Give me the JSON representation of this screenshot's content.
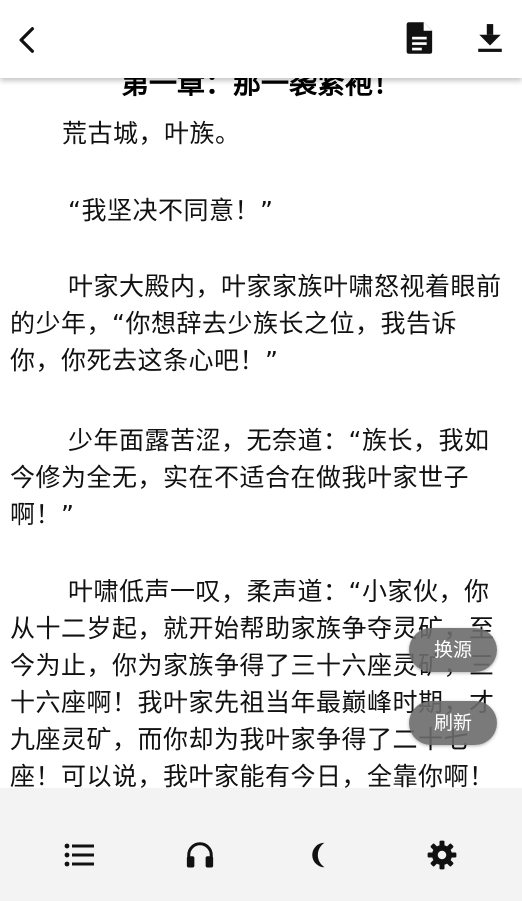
{
  "toolbar": {
    "back_icon": "chevron-left-icon",
    "document_icon": "document-icon",
    "download_icon": "download-icon"
  },
  "reader": {
    "chapter_title": "第一章：那一袭紧袍！",
    "paragraphs": [
      "荒古城，叶族。",
      "“我坚决不同意！”",
      "叶家大殿内，叶家家族叶啸怒视着眼前的少年，“你想辞去少族长之位，我告诉你，你死去这条心吧！”",
      "少年面露苦涩，无奈道：“族长，我如今修为全无，实在不适合在做我叶家世子啊！”",
      "叶啸低声一叹，柔声道：“小家伙，你从十二岁起，就开始帮助家族争夺灵矿，至今为止，你为家族争得了三十六座灵矿，三十六座啊！我叶家先祖当年最巅峰时期，才九座灵矿，而你却为我叶家争得了二十七座！可以说，我叶家能有今日，全靠你啊！你现在虽然修为全无，但是……你"
    ]
  },
  "floating": {
    "change_source": "换源",
    "refresh": "刷新"
  },
  "bottom_nav": {
    "icons": [
      "list-icon",
      "headphones-icon",
      "moon-icon",
      "gear-icon"
    ]
  },
  "colors": {
    "bottom_bar_bg": "#f3f3f3",
    "float_button_bg": "#6c6c6c",
    "text": "#111111"
  }
}
